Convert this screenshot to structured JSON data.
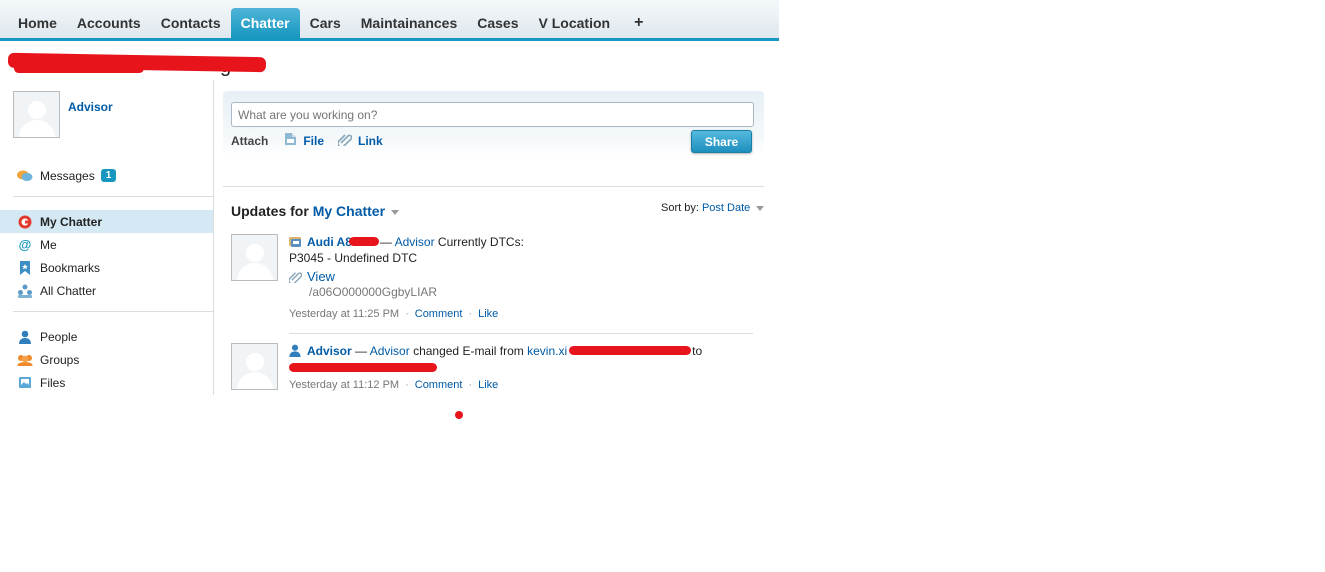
{
  "nav": {
    "tabs": [
      {
        "label": "Home"
      },
      {
        "label": "Accounts"
      },
      {
        "label": "Contacts"
      },
      {
        "label": "Chatter",
        "active": true
      },
      {
        "label": "Cars"
      },
      {
        "label": "Maintainances"
      },
      {
        "label": "Cases"
      },
      {
        "label": "V Location"
      }
    ],
    "plus_label": "+"
  },
  "page": {
    "title_fragment": "g"
  },
  "sidebar": {
    "user_name": "Advisor",
    "messages_label": "Messages",
    "messages_count": "1",
    "feed_items": [
      {
        "label": "My Chatter",
        "icon": "chatter-icon",
        "active": true
      },
      {
        "label": "Me",
        "icon": "at-icon"
      },
      {
        "label": "Bookmarks",
        "icon": "bookmark-icon"
      },
      {
        "label": "All Chatter",
        "icon": "all-chatter-icon"
      }
    ],
    "nav_items": [
      {
        "label": "People",
        "icon": "person-icon"
      },
      {
        "label": "Groups",
        "icon": "groups-icon"
      },
      {
        "label": "Files",
        "icon": "files-icon"
      }
    ]
  },
  "publisher": {
    "placeholder": "What are you working on?",
    "attach_label": "Attach",
    "file_label": "File",
    "link_label": "Link",
    "share_label": "Share"
  },
  "feed": {
    "updates_prefix": "Updates for",
    "updates_filter": "My Chatter",
    "sort_label": "Sort by:",
    "sort_value": "Post Date",
    "posts": [
      {
        "record": "Audi A8",
        "dash": "—",
        "author": "Advisor",
        "text": "Currently DTCs:",
        "body": "P3045 - Undefined DTC",
        "link_label": "View",
        "link_url": "/a06O000000GgbyLIAR",
        "time": "Yesterday at 11:25 PM",
        "comment": "Comment",
        "like": "Like"
      },
      {
        "record": "Advisor",
        "dash": "—",
        "author": "Advisor",
        "text": "changed E-mail from",
        "email_from": "kevin.xi",
        "to_word": "to",
        "time": "Yesterday at 11:12 PM",
        "comment": "Comment",
        "like": "Like"
      }
    ]
  },
  "colors": {
    "accent": "#1797c0",
    "link": "#015ba7",
    "redaction": "#e8141c"
  }
}
